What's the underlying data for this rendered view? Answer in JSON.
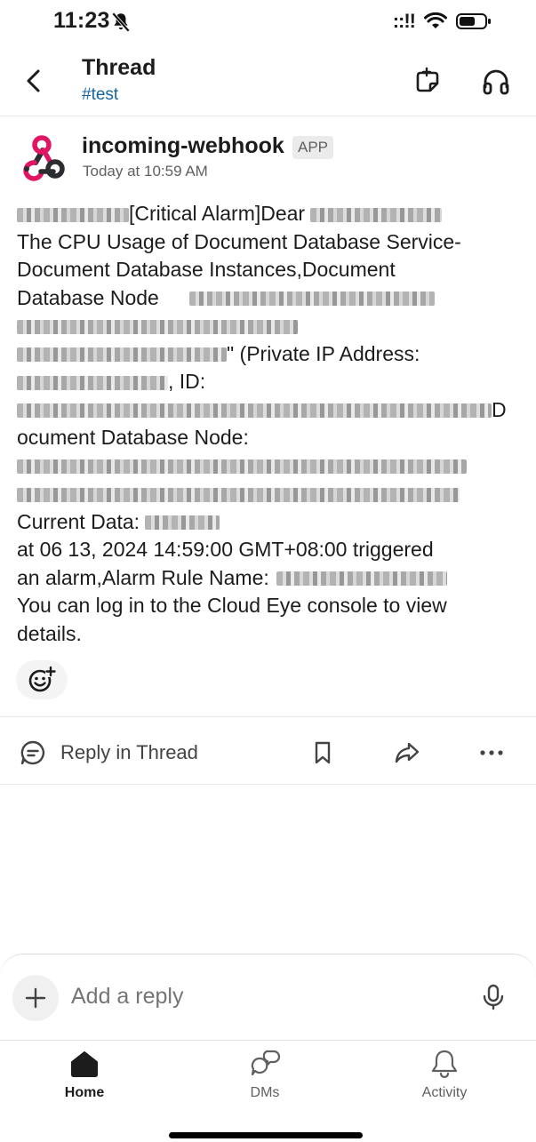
{
  "status_bar": {
    "time": "11:23",
    "signal": "::!!"
  },
  "header": {
    "title": "Thread",
    "channel": "#test"
  },
  "message": {
    "sender": "incoming-webhook",
    "badge": "APP",
    "timestamp": "Today at 10:59 AM",
    "lines": {
      "l1": "[Critical Alarm]Dear",
      "l2": "The CPU Usage of Document Database Service-",
      "l3": "Document Database Instances,Document",
      "l4": "Database Node",
      "l6": "\" (Private IP Address:",
      "l7": ", ID:",
      "l8": "D",
      "l9": "ocument Database Node:",
      "l12": "Current Data:",
      "l13": "at 06 13, 2024 14:59:00 GMT+08:00 triggered",
      "l14": "an alarm,Alarm Rule Name:",
      "l15": "You can log in to the Cloud Eye console to view",
      "l16": "details."
    }
  },
  "actions": {
    "reply_in_thread": "Reply in Thread"
  },
  "composer": {
    "placeholder": "Add a reply"
  },
  "tabs": {
    "home": "Home",
    "dms": "DMs",
    "activity": "Activity"
  },
  "icons": {
    "bell_slash": "bell-slash-icon",
    "wifi": "wifi-icon",
    "battery": "battery-icon",
    "back": "chevron-left-icon",
    "thread_view": "thread-view-icon",
    "huddle": "headphones-icon",
    "avatar": "webhook-icon",
    "emoji_add": "add-reaction-icon",
    "reply": "message-bubble-icon",
    "bookmark": "bookmark-icon",
    "share": "share-icon",
    "more": "more-horizontal-icon",
    "plus": "plus-icon",
    "mic": "microphone-icon",
    "home": "home-icon",
    "dms": "dms-icon",
    "activity": "bell-icon"
  },
  "colors": {
    "link": "#1264a3",
    "text": "#1d1c1d",
    "muted": "#616061",
    "webhook_pink": "#e01563",
    "webhook_dark": "#2c2d30"
  }
}
